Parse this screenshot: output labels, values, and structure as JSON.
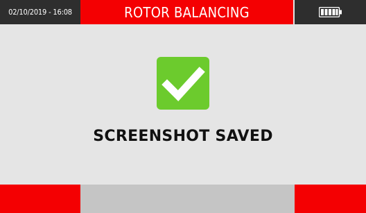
{
  "header": {
    "datetime": "02/10/2019 - 16:08",
    "title": "ROTOR BALANCING",
    "battery_icon": "battery-full-icon"
  },
  "main": {
    "status_icon": "checkmark-icon",
    "message": "SCREENSHOT SAVED"
  },
  "footer": {
    "softkeys": [
      {
        "label": "",
        "color": "#f40002"
      },
      {
        "label": "",
        "color": "#c5c5c5"
      },
      {
        "label": "",
        "color": "#f40002"
      }
    ]
  },
  "colors": {
    "accent_red": "#f40002",
    "header_dark": "#2e2e2e",
    "background": "#e5e5e5",
    "success_green": "#6ccb2d"
  }
}
